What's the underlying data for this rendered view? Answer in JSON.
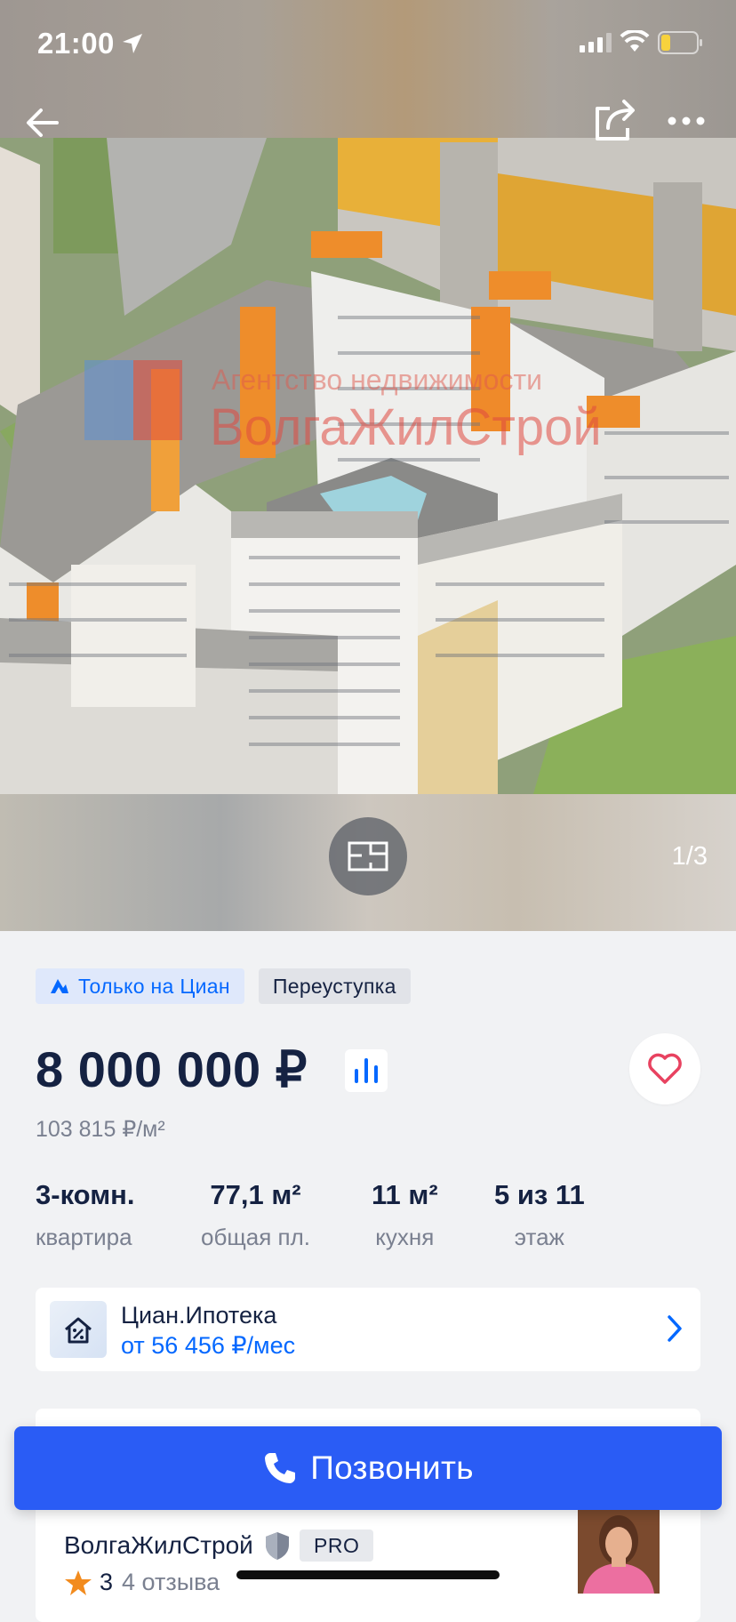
{
  "status_bar": {
    "time": "21:00"
  },
  "photo": {
    "counter": "1/3",
    "watermark_line1": "Агентство недвижимости",
    "watermark_line2": "ВолгаЖилСтрой"
  },
  "badges": [
    {
      "label": "Только на Циан",
      "icon": "cian-logo-icon"
    },
    {
      "label": "Переуступка"
    }
  ],
  "listing": {
    "price": "8 000 000 ₽",
    "price_per_m2": "103 815 ₽/м²",
    "facts": [
      {
        "value": "3-комн.",
        "label": "квартира"
      },
      {
        "value": "77,1 м²",
        "label": "общая пл."
      },
      {
        "value": "11 м²",
        "label": "кухня"
      },
      {
        "value": "5 из 11",
        "label": "этаж"
      }
    ]
  },
  "mortgage": {
    "title": "Циан.Ипотека",
    "subtitle": "от 56 456 ₽/мес"
  },
  "agent": {
    "name": "ВолгаЖилСтрой",
    "badge": "PRO",
    "rating": "3",
    "reviews": "4 отзыва"
  },
  "call_button": {
    "label": "Позвонить"
  },
  "colors": {
    "accent": "#0468ff",
    "call_button": "#2a5cf5",
    "favorite_heart": "#e84260",
    "text_primary": "#152242",
    "text_secondary": "#7a8090"
  }
}
